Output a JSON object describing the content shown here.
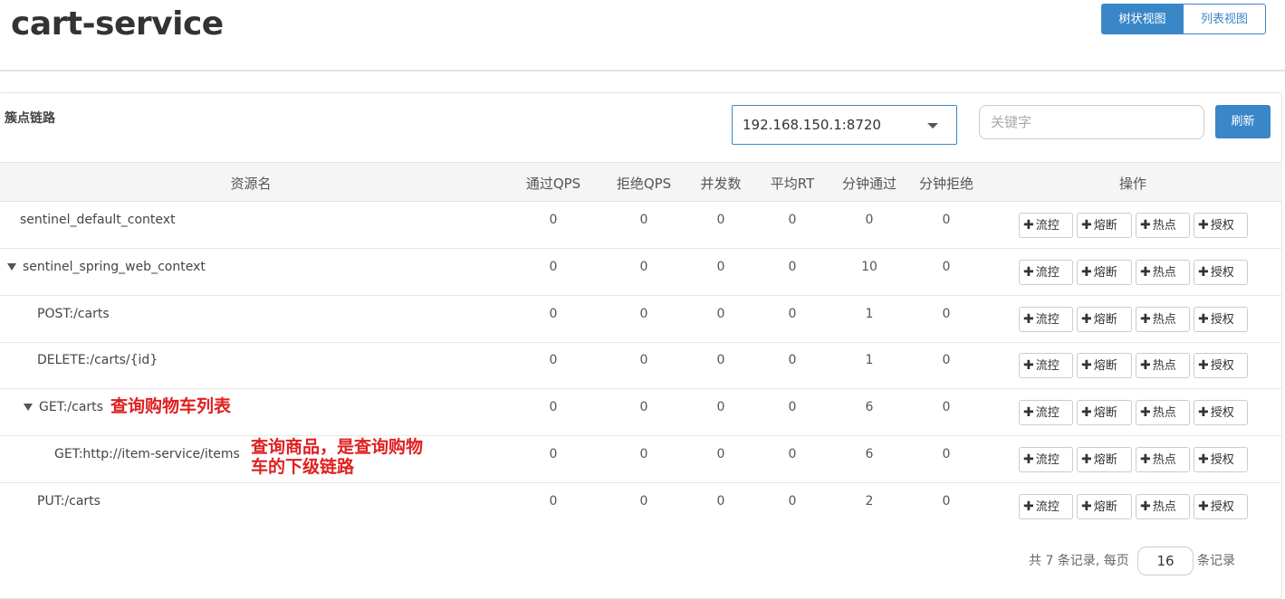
{
  "app": {
    "title": "cart-service",
    "views": {
      "tree": "树状视图",
      "list": "列表视图"
    }
  },
  "panel": {
    "title": "簇点链路",
    "machine": "192.168.150.1:8720",
    "search_placeholder": "关键字",
    "refresh_label": "刷新"
  },
  "table": {
    "headers": [
      "资源名",
      "通过QPS",
      "拒绝QPS",
      "并发数",
      "平均RT",
      "分钟通过",
      "分钟拒绝",
      "操作"
    ],
    "actions": [
      "流控",
      "熔断",
      "热点",
      "授权"
    ],
    "rows": [
      {
        "name": "sentinel_default_context",
        "pass_qps": "0",
        "block_qps": "0",
        "concurrency": "0",
        "avg_rt": "0",
        "min_pass": "0",
        "min_block": "0"
      },
      {
        "name": "sentinel_spring_web_context",
        "pass_qps": "0",
        "block_qps": "0",
        "concurrency": "0",
        "avg_rt": "0",
        "min_pass": "10",
        "min_block": "0"
      },
      {
        "name": "POST:/carts",
        "pass_qps": "0",
        "block_qps": "0",
        "concurrency": "0",
        "avg_rt": "0",
        "min_pass": "1",
        "min_block": "0"
      },
      {
        "name": "DELETE:/carts/{id}",
        "pass_qps": "0",
        "block_qps": "0",
        "concurrency": "0",
        "avg_rt": "0",
        "min_pass": "1",
        "min_block": "0"
      },
      {
        "name": "GET:/carts",
        "pass_qps": "0",
        "block_qps": "0",
        "concurrency": "0",
        "avg_rt": "0",
        "min_pass": "6",
        "min_block": "0"
      },
      {
        "name": "GET:http://item-service/items",
        "pass_qps": "0",
        "block_qps": "0",
        "concurrency": "0",
        "avg_rt": "0",
        "min_pass": "6",
        "min_block": "0"
      },
      {
        "name": "PUT:/carts",
        "pass_qps": "0",
        "block_qps": "0",
        "concurrency": "0",
        "avg_rt": "0",
        "min_pass": "2",
        "min_block": "0"
      }
    ]
  },
  "annotations": {
    "get_carts": "查询购物车列表",
    "item_line1": "查询商品，是查询购物",
    "item_line2": "车的下级链路"
  },
  "pagination": {
    "summary": "共 7 条记录, 每页",
    "page_size": "16",
    "suffix": "条记录"
  }
}
